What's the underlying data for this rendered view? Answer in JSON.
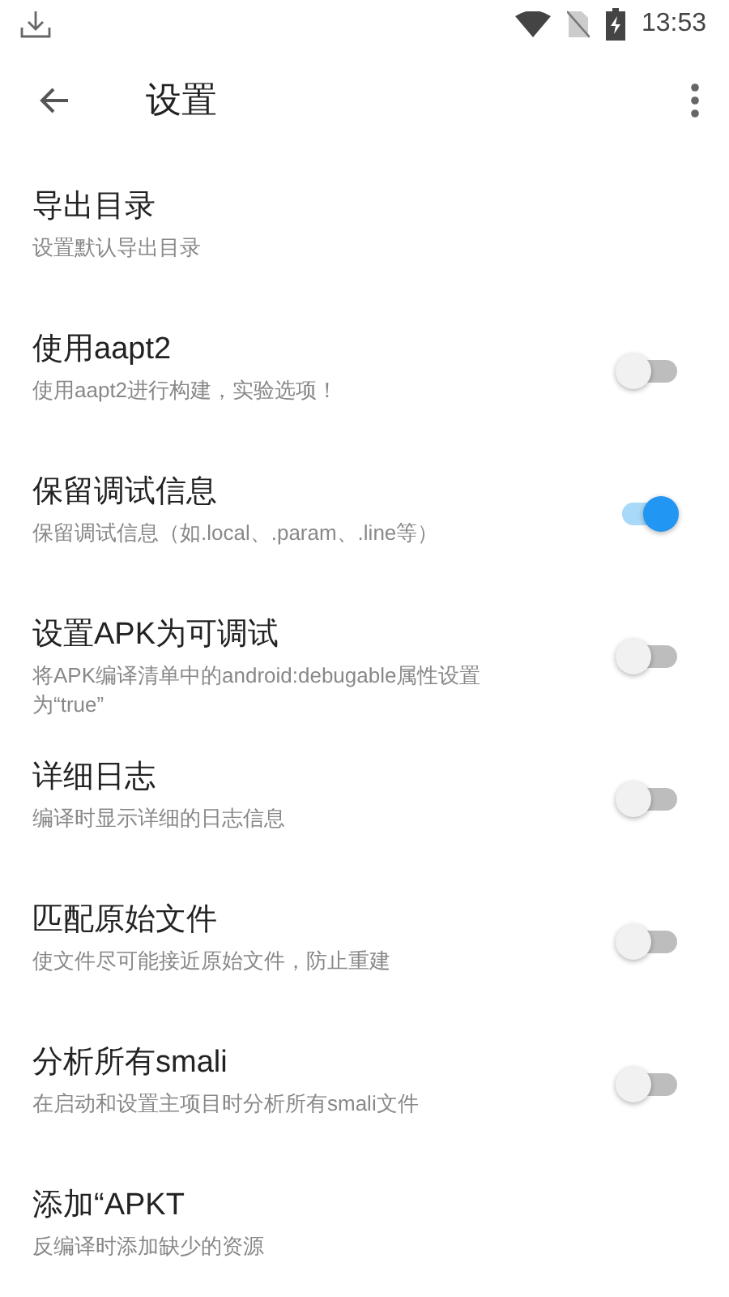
{
  "status_bar": {
    "time": "13:53"
  },
  "toolbar": {
    "title": "设置"
  },
  "settings": [
    {
      "kind": "plain",
      "title": "导出目录",
      "summary": "设置默认导出目录"
    },
    {
      "kind": "switch",
      "title": "使用aapt2",
      "summary": "使用aapt2进行构建，实验选项！",
      "on": false
    },
    {
      "kind": "switch",
      "title": "保留调试信息",
      "summary": "保留调试信息（如.local、.param、.line等）",
      "on": true
    },
    {
      "kind": "switch",
      "title": "设置APK为可调试",
      "summary": "将APK编译清单中的android:debugable属性设置为“true”",
      "on": false
    },
    {
      "kind": "switch",
      "title": "详细日志",
      "summary": "编译时显示详细的日志信息",
      "on": false
    },
    {
      "kind": "switch",
      "title": "匹配原始文件",
      "summary": "使文件尽可能接近原始文件，防止重建",
      "on": false
    },
    {
      "kind": "switch",
      "title": "分析所有smali",
      "summary": "在启动和设置主项目时分析所有smali文件",
      "on": false
    },
    {
      "kind": "plain",
      "title": "添加“APKT",
      "summary": "反编译时添加缺少的资源"
    }
  ]
}
